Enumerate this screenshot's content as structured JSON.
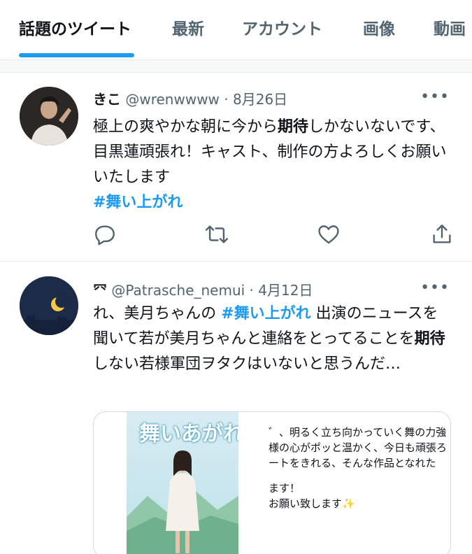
{
  "tabs": [
    {
      "label": "話題のツイート",
      "active": true
    },
    {
      "label": "最新",
      "active": false
    },
    {
      "label": "アカウント",
      "active": false
    },
    {
      "label": "画像",
      "active": false
    },
    {
      "label": "動画",
      "active": false
    }
  ],
  "tweets": [
    {
      "name": "きこ",
      "handle": "@wrenwwww",
      "sep": " · ",
      "date": "8月26日",
      "more": "•••",
      "text_a": "極上の爽やかな朝に今から",
      "text_kw": "期待",
      "text_b": "しかないないです、目黒蓮頑張れ！キャスト、制作の方よろしくお願いいたします",
      "hashtag": "#舞い上がれ"
    },
    {
      "name": "㓁",
      "handle": "@Patrasche_nemui",
      "sep": " · ",
      "date": "4月12日",
      "more": "•••",
      "text_a": "れ、美月ちゃんの ",
      "hashtag": "#舞い上がれ",
      "text_b": " 出演のニュースを聞いて若が美月ちゃんと連絡をとってることを",
      "text_kw": "期待",
      "text_c": "しない若様軍団ヲタクはいないと思うんだ…",
      "card": {
        "poster_title": "舞いあがれ!",
        "lines": [
          "゛、明るく立ち向かっていく舞の力強",
          "様の心がポッと温かく、今日も頑張ろ",
          "ートをきれる、そんな作品となれた",
          "",
          "ます！",
          "お願い致します✨"
        ]
      }
    }
  ],
  "icons": {
    "reply": "reply-icon",
    "retweet": "retweet-icon",
    "like": "like-icon",
    "share": "share-icon"
  },
  "colors": {
    "accent": "#1d9bf0",
    "text": "#0f1419",
    "muted": "#536471"
  }
}
